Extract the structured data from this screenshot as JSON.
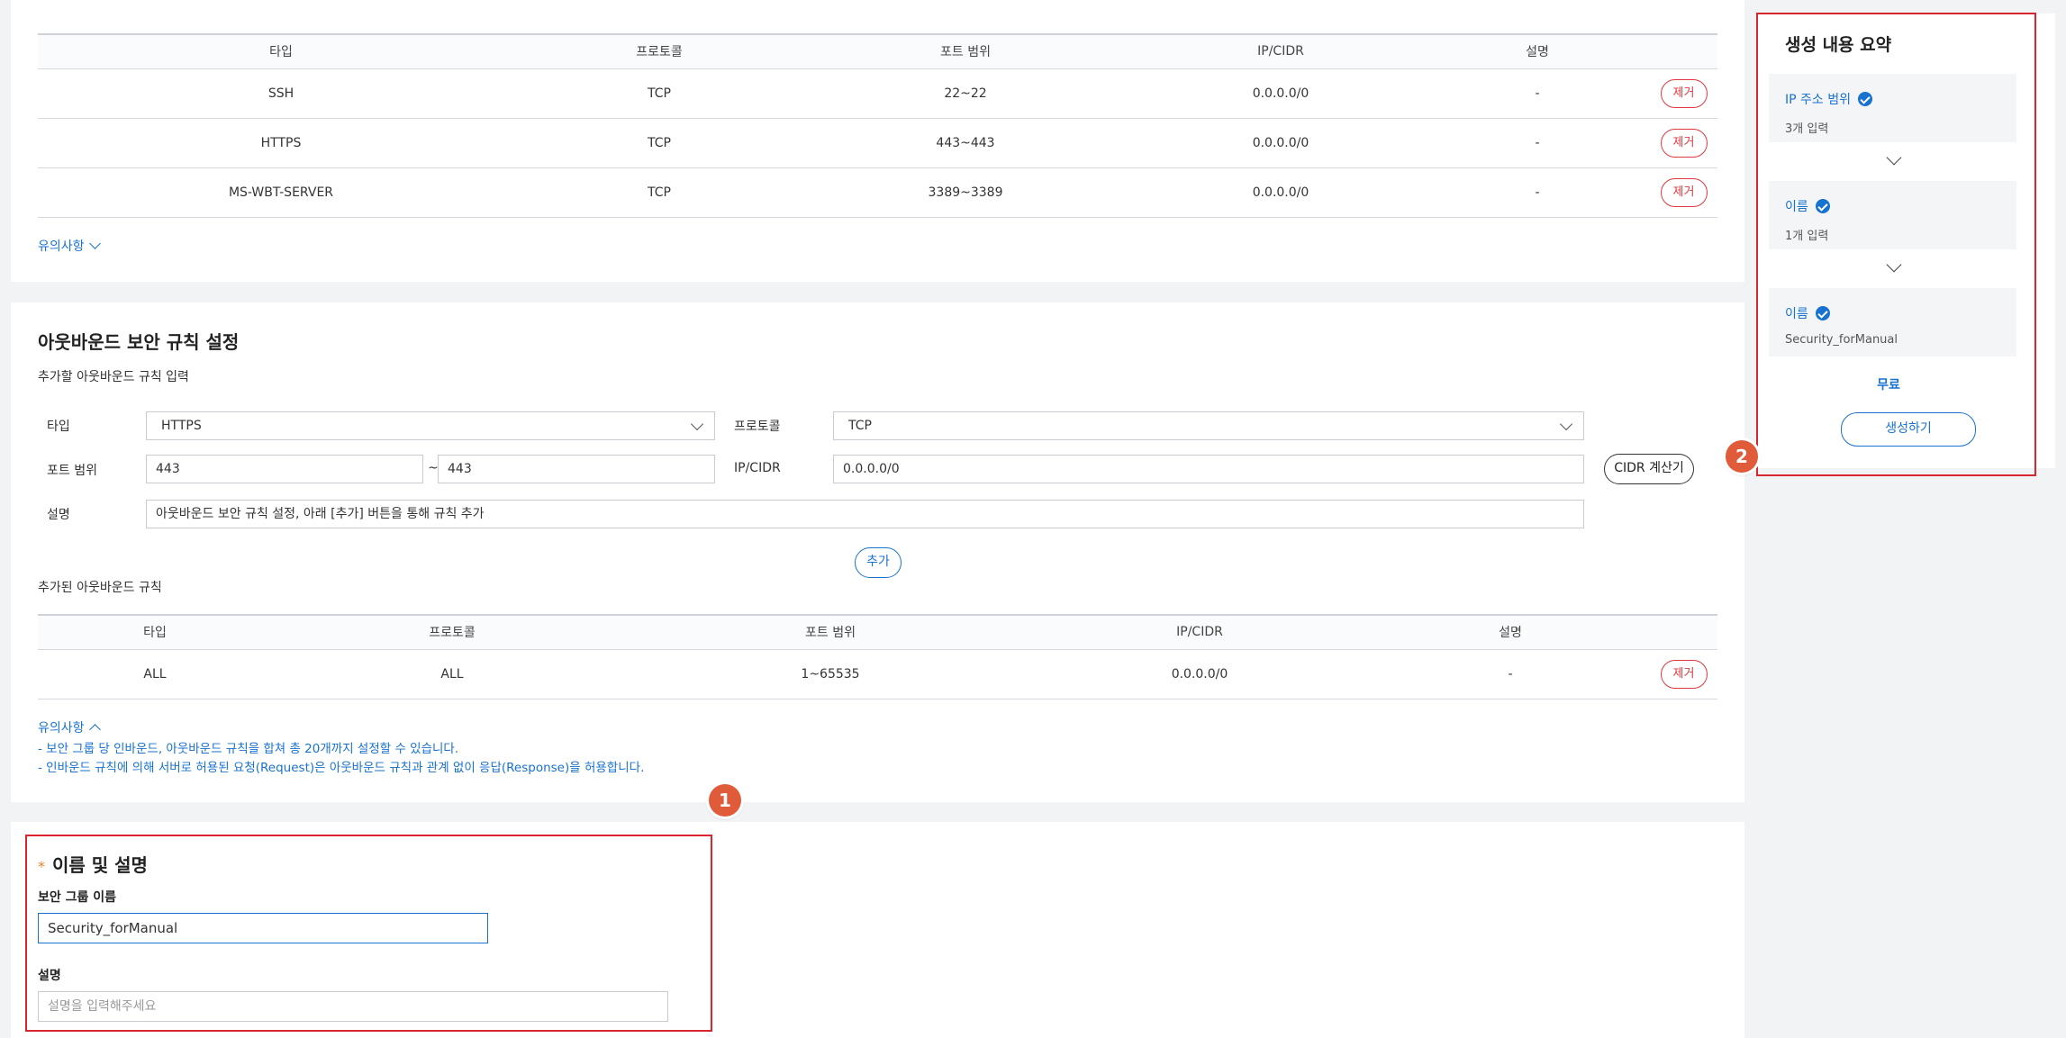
{
  "inbound": {
    "headers": [
      "타입",
      "프로토콜",
      "포트 범위",
      "IP/CIDR",
      "설명",
      ""
    ],
    "rows": [
      {
        "type": "SSH",
        "protocol": "TCP",
        "port": "22~22",
        "cidr": "0.0.0.0/0",
        "desc": "-",
        "remove": "제거"
      },
      {
        "type": "HTTPS",
        "protocol": "TCP",
        "port": "443~443",
        "cidr": "0.0.0.0/0",
        "desc": "-",
        "remove": "제거"
      },
      {
        "type": "MS-WBT-SERVER",
        "protocol": "TCP",
        "port": "3389~3389",
        "cidr": "0.0.0.0/0",
        "desc": "-",
        "remove": "제거"
      }
    ],
    "notice_label": "유의사항"
  },
  "outbound": {
    "title": "아웃바운드 보안 규칙 설정",
    "subtitle": "추가할 아웃바운드 규칙 입력",
    "type_label": "타입",
    "type_value": "HTTPS",
    "protocol_label": "프로토콜",
    "protocol_value": "TCP",
    "port_label": "포트 범위",
    "port_from": "443",
    "port_sep": "~",
    "port_to": "443",
    "cidr_label": "IP/CIDR",
    "cidr_value": "0.0.0.0/0",
    "cidr_calc_button": "CIDR 계산기",
    "desc_label": "설명",
    "desc_value": "아웃바운드 보안 규칙 설정, 아래 [추가] 버튼을 통해 규칙 추가",
    "add_button": "추가",
    "added_title": "추가된 아웃바운드 규칙",
    "headers": [
      "타입",
      "프로토콜",
      "포트 범위",
      "IP/CIDR",
      "설명",
      ""
    ],
    "rows": [
      {
        "type": "ALL",
        "protocol": "ALL",
        "port": "1~65535",
        "cidr": "0.0.0.0/0",
        "desc": "-",
        "remove": "제거"
      }
    ],
    "notice_label": "유의사항",
    "notice_lines": [
      "- 보안 그룹 당 인바운드, 아웃바운드 규칙을 합쳐 총 20개까지 설정할 수 있습니다.",
      "- 인바운드 규칙에 의해 서버로 허용된 요청(Request)은 아웃바운드 규칙과 관계 없이 응답(Response)을 허용합니다."
    ]
  },
  "name_section": {
    "required_mark": "*",
    "title": "이름 및 설명",
    "group_name_label": "보안 그룹 이름",
    "group_name_value": "Security_forManual",
    "desc_label": "설명",
    "desc_placeholder": "설명을 입력해주세요"
  },
  "summary": {
    "title": "생성 내용 요약",
    "items": [
      {
        "title": "IP 주소 범위",
        "sub": "3개 입력"
      },
      {
        "title": "이름",
        "sub": "1개 입력"
      },
      {
        "title": "이름",
        "sub": "Security_forManual"
      }
    ],
    "price": "무료",
    "create_button": "생성하기"
  },
  "callouts": [
    "1",
    "2"
  ],
  "colors": {
    "accent": "#1872d0",
    "danger": "#e0383e",
    "highlight": "#d7262e",
    "badge": "#e05b3a"
  }
}
